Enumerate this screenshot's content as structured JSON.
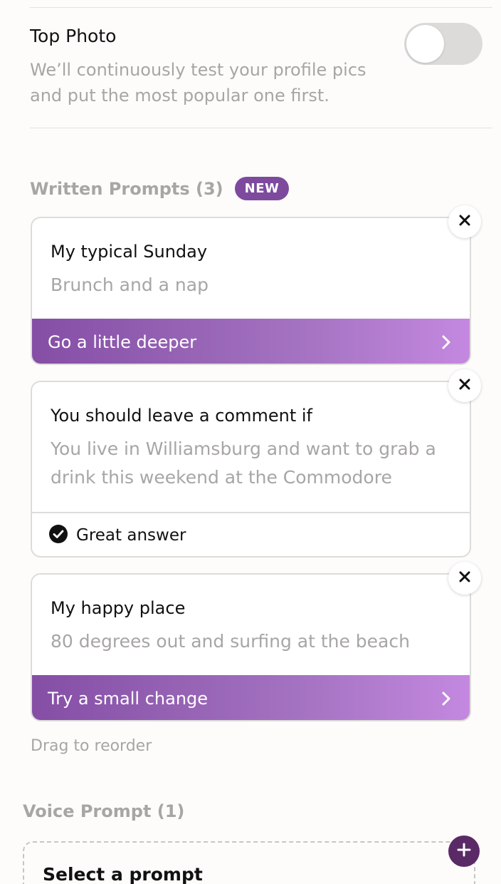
{
  "top_photo": {
    "title": "Top Photo",
    "description": "We’ll continuously test your profile pics and put the most popular one first.",
    "toggle_on": false
  },
  "written_prompts": {
    "label": "Written Prompts (3)",
    "badge": "NEW",
    "items": [
      {
        "question": "My typical Sunday",
        "answer": "Brunch and a nap",
        "action": "Go a little deeper"
      },
      {
        "question": "You should leave a comment if",
        "answer": "You live in Williamsburg and want to grab a drink this weekend at the Commodore",
        "status": "Great answer"
      },
      {
        "question": "My happy place",
        "answer": "80 degrees out and surfing at the beach",
        "action": "Try a small change"
      }
    ],
    "drag_hint": "Drag to reorder"
  },
  "voice_prompt": {
    "label": "Voice Prompt (1)",
    "select_label": "Select a prompt"
  },
  "colors": {
    "accent": "#7d4a9e",
    "cta_gradient_start": "#844ea5",
    "cta_gradient_end": "#c488e0",
    "add_button": "#5a2a66",
    "muted_text": "#a8a6a4"
  },
  "icons": {
    "close": "close-icon",
    "chevron": "chevron-right-icon",
    "check": "check-circle-icon",
    "plus": "plus-icon"
  }
}
